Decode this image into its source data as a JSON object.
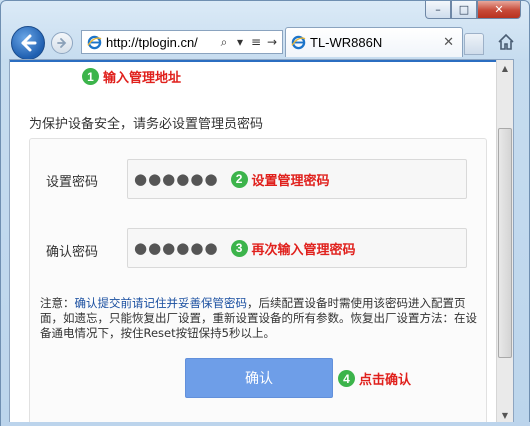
{
  "window": {
    "minimize_glyph": "–",
    "maximize_glyph": "□",
    "close_glyph": "✕"
  },
  "toolbar": {
    "address_url": "http://tplogin.cn/",
    "search_glyph": "⌕",
    "dropdown_glyph": "▾",
    "compat_glyph": "≡",
    "refresh_glyph": "→",
    "tab_title": "TL-WR886N",
    "tab_close_glyph": "✕"
  },
  "annotations": {
    "step1": {
      "num": "1",
      "text": "输入管理地址"
    },
    "step2": {
      "num": "2",
      "text": "设置管理密码"
    },
    "step3": {
      "num": "3",
      "text": "再次输入管理密码"
    },
    "step4": {
      "num": "4",
      "text": "点击确认"
    }
  },
  "form": {
    "intro": "为保护设备安全，请务必设置管理员密码",
    "password_label": "设置密码",
    "password_value": "●●●●●●",
    "confirm_label": "确认密码",
    "confirm_value": "●●●●●●",
    "note_prefix": "注意：",
    "note_highlight": "确认提交前请记住并妥善保管密码",
    "note_rest": "，后续配置设备时需使用该密码进入配置页面，如遗忘，只能恢复出厂设置，重新设置设备的所有参数。恢复出厂设置方法：在设备通电情况下，按住Reset按钮保持5秒以上。",
    "submit_label": "确认"
  },
  "colors": {
    "accent_blue": "#2b6ec1",
    "button_blue": "#6e9ee8",
    "annotation_red": "#e0201c",
    "badge_green": "#3cb44b"
  }
}
